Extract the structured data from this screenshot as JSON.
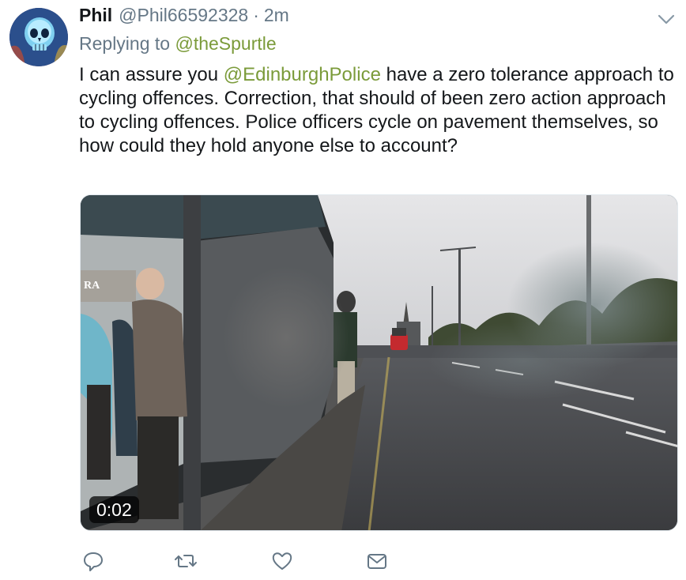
{
  "tweet": {
    "author_name": "Phil",
    "author_handle": "@Phil66592328",
    "separator": "·",
    "timestamp": "2m",
    "replying_prefix": "Replying to ",
    "replying_to": "@theSpurtle",
    "text_before_mention": "I can assure you ",
    "text_mention": "@EdinburghPolice",
    "text_after_mention": " have a zero tolerance approach to cycling offences. Correction, that should of been zero action approach to cycling offences. Police officers cycle on pavement themselves, so how could they hold anyone else to account?"
  },
  "media": {
    "duration": "0:02",
    "sign_text": "RA"
  },
  "actions": {
    "icons": [
      "reply-icon",
      "retweet-icon",
      "like-icon",
      "direct-message-icon"
    ]
  },
  "colors": {
    "mention": "#7b9b3a",
    "secondary_text": "#657786",
    "primary_text": "#14171a"
  }
}
